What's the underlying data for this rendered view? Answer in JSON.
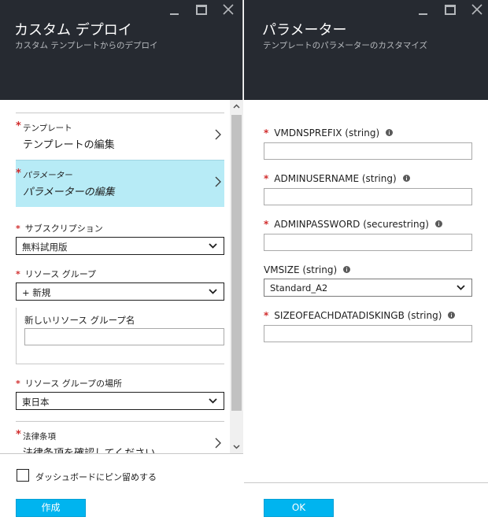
{
  "left_blade": {
    "title": "カスタム デプロイ",
    "subtitle": "カスタム テンプレートからのデプロイ",
    "items": {
      "template": {
        "label": "テンプレート",
        "value": "テンプレートの編集"
      },
      "parameters": {
        "label": "パラメーター",
        "value": "パラメーターの編集"
      },
      "legal": {
        "label": "法律条項",
        "value": "法律条項を確認してください"
      }
    },
    "subscription": {
      "label": "サブスクリプション",
      "value": "無料試用版"
    },
    "resource_group": {
      "label": "リソース グループ",
      "value": "+ 新規",
      "new_name_label": "新しいリソース グループ名",
      "new_name_value": ""
    },
    "location": {
      "label": "リソース グループの場所",
      "value": "東日本"
    },
    "pin_label": "ダッシュボードにピン留めする",
    "create_button": "作成"
  },
  "right_blade": {
    "title": "パラメーター",
    "subtitle": "テンプレートのパラメーターのカスタマイズ",
    "params": {
      "vmdnsprefix": {
        "label": "VMDNSPREFIX (string)",
        "value": ""
      },
      "adminusername": {
        "label": "ADMINUSERNAME (string)",
        "value": ""
      },
      "adminpassword": {
        "label": "ADMINPASSWORD (securestring)",
        "value": ""
      },
      "vmsize": {
        "label": "VMSIZE (string)",
        "value": "Standard_A2"
      },
      "sizeofeachdatadisk": {
        "label": "SIZEOFEACHDATADISKINGB (string)",
        "value": ""
      }
    },
    "ok_button": "OK"
  },
  "colors": {
    "header_bg": "#262a31",
    "selected_bg": "#b7ebf6",
    "required": "#d12d2d",
    "primary_button": "#00b4ef"
  }
}
